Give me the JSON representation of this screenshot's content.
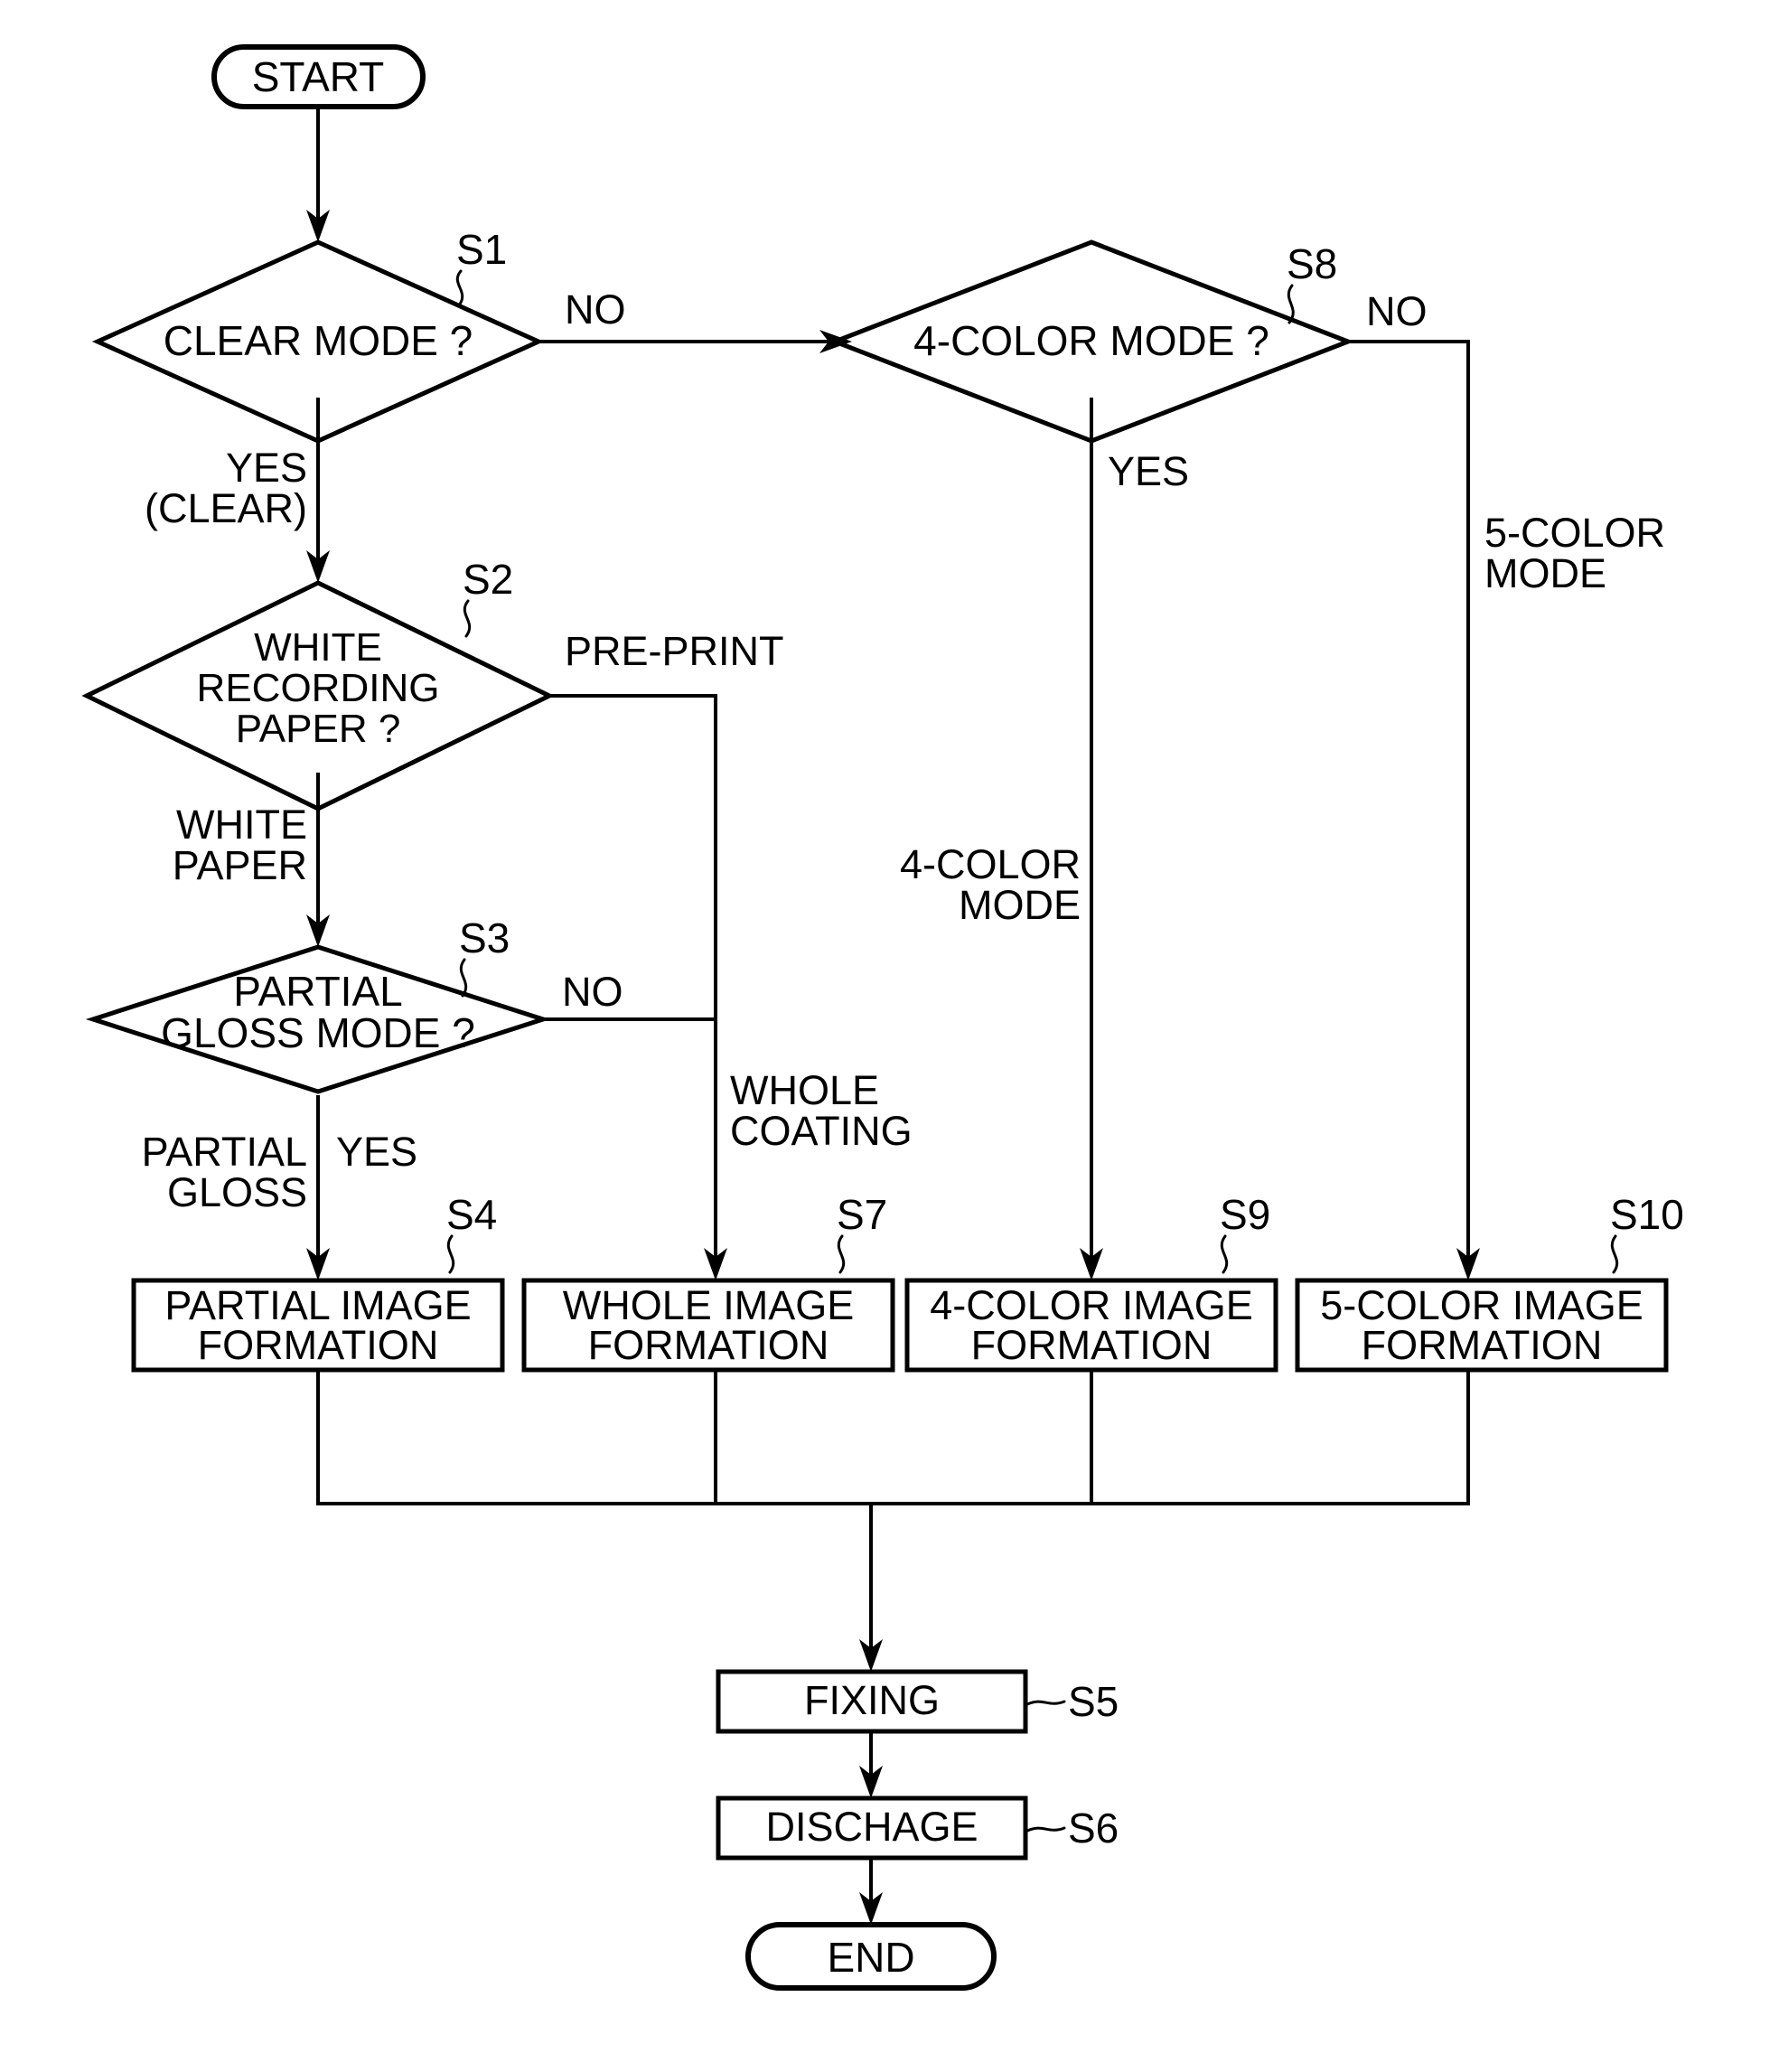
{
  "diagram": {
    "title": "Image formation mode selection flowchart",
    "stroke_color": "#000000",
    "background_color": "#ffffff"
  },
  "terminators": {
    "start": "START",
    "end": "END"
  },
  "decisions": [
    {
      "id": "S1",
      "step": "S1",
      "text": "CLEAR MODE ?"
    },
    {
      "id": "S2",
      "step": "S2",
      "line1": "WHITE",
      "line2": "RECORDING",
      "line3": "PAPER ?"
    },
    {
      "id": "S3",
      "step": "S3",
      "line1": "PARTIAL",
      "line2": "GLOSS MODE ?"
    },
    {
      "id": "S8",
      "step": "S8",
      "text": "4-COLOR MODE ?"
    }
  ],
  "processes": [
    {
      "id": "S4",
      "step": "S4",
      "line1": "PARTIAL IMAGE",
      "line2": "FORMATION"
    },
    {
      "id": "S7",
      "step": "S7",
      "line1": "WHOLE IMAGE",
      "line2": "FORMATION"
    },
    {
      "id": "S9",
      "step": "S9",
      "line1": "4-COLOR IMAGE",
      "line2": "FORMATION"
    },
    {
      "id": "S10",
      "step": "S10",
      "line1": "5-COLOR IMAGE",
      "line2": "FORMATION"
    },
    {
      "id": "S5",
      "step": "S5",
      "line1": "FIXING"
    },
    {
      "id": "S6",
      "step": "S6",
      "line1": "DISCHAGE"
    }
  ],
  "edge_labels": {
    "s1_no": "NO",
    "s1_yes_line1": "YES",
    "s1_yes_line2": "(CLEAR)",
    "s2_preprint": "PRE-PRINT",
    "s2_white_line1": "WHITE",
    "s2_white_line2": "PAPER",
    "s3_no": "NO",
    "s3_yes": "YES",
    "s3_partial_line1": "PARTIAL",
    "s3_partial_line2": "GLOSS",
    "whole_coating_line1": "WHOLE",
    "whole_coating_line2": "COATING",
    "s8_no": "NO",
    "s8_yes": "YES",
    "four_color_line1": "4-COLOR",
    "four_color_line2": "MODE",
    "five_color_line1": "5-COLOR",
    "five_color_line2": "MODE"
  },
  "step_labels": {
    "s1": "S1",
    "s2": "S2",
    "s3": "S3",
    "s4": "S4",
    "s5": "S5",
    "s6": "S6",
    "s7": "S7",
    "s8": "S8",
    "s9": "S9",
    "s10": "S10"
  }
}
